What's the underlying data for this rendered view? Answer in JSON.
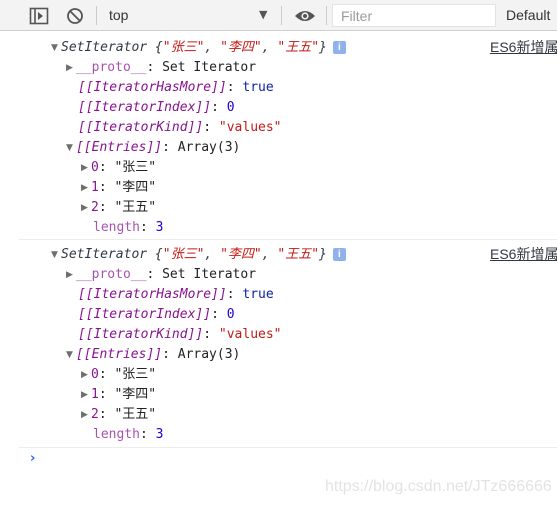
{
  "toolbar": {
    "context": "top",
    "filter_placeholder": "Filter",
    "levels": "Default"
  },
  "entries": [
    {
      "header": {
        "ctor": "SetIterator",
        "open": "{",
        "v0": "\"张三\"",
        "v1": "\"李四\"",
        "v2": "\"王五\"",
        "sep": ", ",
        "close": "}"
      },
      "info": "i",
      "source": "ES6新增属",
      "proto": {
        "key": "__proto__",
        "sep": ": ",
        "value": "Set Iterator"
      },
      "has_more": {
        "key": "[[IteratorHasMore]]",
        "sep": ": ",
        "value": "true"
      },
      "index": {
        "key": "[[IteratorIndex]]",
        "sep": ": ",
        "value": "0"
      },
      "kind": {
        "key": "[[IteratorKind]]",
        "sep": ": ",
        "value": "\"values\""
      },
      "entries": {
        "key": "[[Entries]]",
        "sep": ": ",
        "value": "Array(3)"
      },
      "items": [
        {
          "key": "0",
          "sep": ": ",
          "value": "\"张三\""
        },
        {
          "key": "1",
          "sep": ": ",
          "value": "\"李四\""
        },
        {
          "key": "2",
          "sep": ": ",
          "value": "\"王五\""
        }
      ],
      "length": {
        "key": "length",
        "sep": ": ",
        "value": "3"
      }
    },
    {
      "header": {
        "ctor": "SetIterator",
        "open": "{",
        "v0": "\"张三\"",
        "v1": "\"李四\"",
        "v2": "\"王五\"",
        "sep": ", ",
        "close": "}"
      },
      "info": "i",
      "source": "ES6新增属",
      "proto": {
        "key": "__proto__",
        "sep": ": ",
        "value": "Set Iterator"
      },
      "has_more": {
        "key": "[[IteratorHasMore]]",
        "sep": ": ",
        "value": "true"
      },
      "index": {
        "key": "[[IteratorIndex]]",
        "sep": ": ",
        "value": "0"
      },
      "kind": {
        "key": "[[IteratorKind]]",
        "sep": ": ",
        "value": "\"values\""
      },
      "entries": {
        "key": "[[Entries]]",
        "sep": ": ",
        "value": "Array(3)"
      },
      "items": [
        {
          "key": "0",
          "sep": ": ",
          "value": "\"张三\""
        },
        {
          "key": "1",
          "sep": ": ",
          "value": "\"李四\""
        },
        {
          "key": "2",
          "sep": ": ",
          "value": "\"王五\""
        }
      ],
      "length": {
        "key": "length",
        "sep": ": ",
        "value": "3"
      }
    }
  ],
  "prompt": "›",
  "watermark": "https://blog.csdn.net/JTz666666",
  "icons": [
    "toggle-sidebar-icon",
    "clear-console-icon",
    "dropdown-arrow-icon",
    "eye-icon",
    "info-icon",
    "expand-arrow-icon",
    "prompt-chevron-icon"
  ],
  "colors": {
    "key": "#881391",
    "string": "#c41a16",
    "number": "#1c00cf",
    "keyword": "#0d22aa",
    "prompt": "#2d6fd8",
    "toolbar": "#f3f3f3"
  }
}
